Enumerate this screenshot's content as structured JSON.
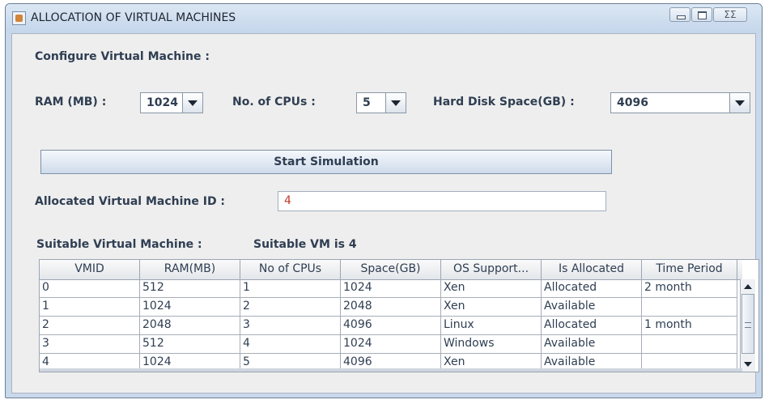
{
  "window": {
    "title": "ALLOCATION OF VIRTUAL MACHINES",
    "icons": {
      "app": "java-app-icon",
      "minimize": "minimize-icon",
      "maximize": "maximize-icon",
      "close": "close-icon"
    },
    "close_glyph": "ΣΣ"
  },
  "configure": {
    "heading": "Configure Virtual Machine :",
    "ram_label": "RAM (MB) :",
    "ram_value": "1024",
    "cpus_label": "No. of CPUs :",
    "cpus_value": "5",
    "disk_label": "Hard Disk Space(GB) :",
    "disk_value": "4096"
  },
  "start_button": "Start Simulation",
  "allocated": {
    "label": "Allocated Virtual Machine ID :",
    "value": "4"
  },
  "suitable": {
    "label": "Suitable Virtual Machine :",
    "value": "Suitable VM is 4"
  },
  "table": {
    "columns": [
      "VMID",
      "RAM(MB)",
      "No of CPUs",
      "Space(GB)",
      "OS Support...",
      "Is Allocated",
      "Time Period"
    ],
    "rows": [
      [
        "0",
        "512",
        "1",
        "1024",
        "Xen",
        "Allocated",
        "2 month"
      ],
      [
        "1",
        "1024",
        "2",
        "2048",
        "Xen",
        "Available",
        ""
      ],
      [
        "2",
        "2048",
        "3",
        "4096",
        "Linux",
        "Allocated",
        "1 month"
      ],
      [
        "3",
        "512",
        "4",
        "1024",
        "Windows",
        "Available",
        ""
      ],
      [
        "4",
        "1024",
        "5",
        "4096",
        "Xen",
        "Available",
        ""
      ]
    ]
  },
  "colors": {
    "title_bg": "#c9d8ea",
    "content_bg": "#eeeeee",
    "label_text": "#2f3e52",
    "allocated_id_text": "#c0392b"
  }
}
